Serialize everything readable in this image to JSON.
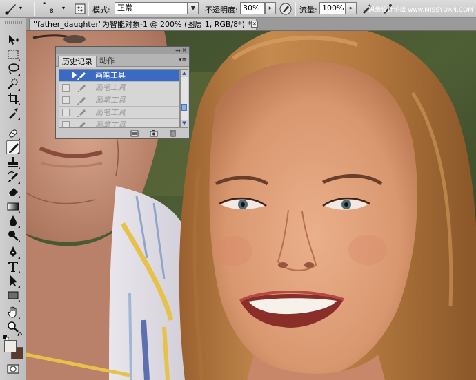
{
  "options_bar": {
    "brush_size": "8",
    "mode_label": "模式:",
    "mode_value": "正常",
    "opacity_label": "不透明度:",
    "opacity_value": "30%",
    "flow_label": "流量:",
    "flow_value": "100%",
    "watermark": "思缘设计论坛 www.MISSYUAN.COM"
  },
  "document": {
    "tab_title": "\"father_daughter\"为智能对象-1 @ 200% (图层 1, RGB/8*) *",
    "close_glyph": "×"
  },
  "history_panel": {
    "tabs": [
      "历史记录",
      "动作"
    ],
    "collapse_glyph": "◂◂",
    "close_glyph": "×",
    "menu_glyph": "▾≡",
    "rows": [
      {
        "label": "画笔工具",
        "selected": true
      },
      {
        "label": "画笔工具",
        "selected": false
      },
      {
        "label": "画笔工具",
        "selected": false
      },
      {
        "label": "画笔工具",
        "selected": false
      },
      {
        "label": "画笔工具",
        "selected": false
      }
    ],
    "footer_icons": [
      "new-document-from-state-icon",
      "new-snapshot-icon",
      "trash-icon"
    ]
  },
  "toolbox": {
    "tools": [
      "move-tool-icon",
      "marquee-tool-icon",
      "lasso-tool-icon",
      "quick-selection-tool-icon",
      "crop-tool-icon",
      "eyedropper-tool-icon",
      "healing-brush-tool-icon",
      "brush-tool-icon",
      "clone-stamp-tool-icon",
      "history-brush-tool-icon",
      "eraser-tool-icon",
      "gradient-tool-icon",
      "blur-tool-icon",
      "dodge-tool-icon",
      "pen-tool-icon",
      "type-tool-icon",
      "path-selection-tool-icon",
      "rectangle-tool-icon",
      "hand-tool-icon",
      "zoom-tool-icon"
    ],
    "active_tool": "brush-tool-icon",
    "foreground_color": "#f1ebe6",
    "background_color": "#5a3a2a"
  },
  "colors": {
    "selection_blue": "#3a6bc4",
    "hair": "#b8793e",
    "skin": "#e3a47f"
  }
}
